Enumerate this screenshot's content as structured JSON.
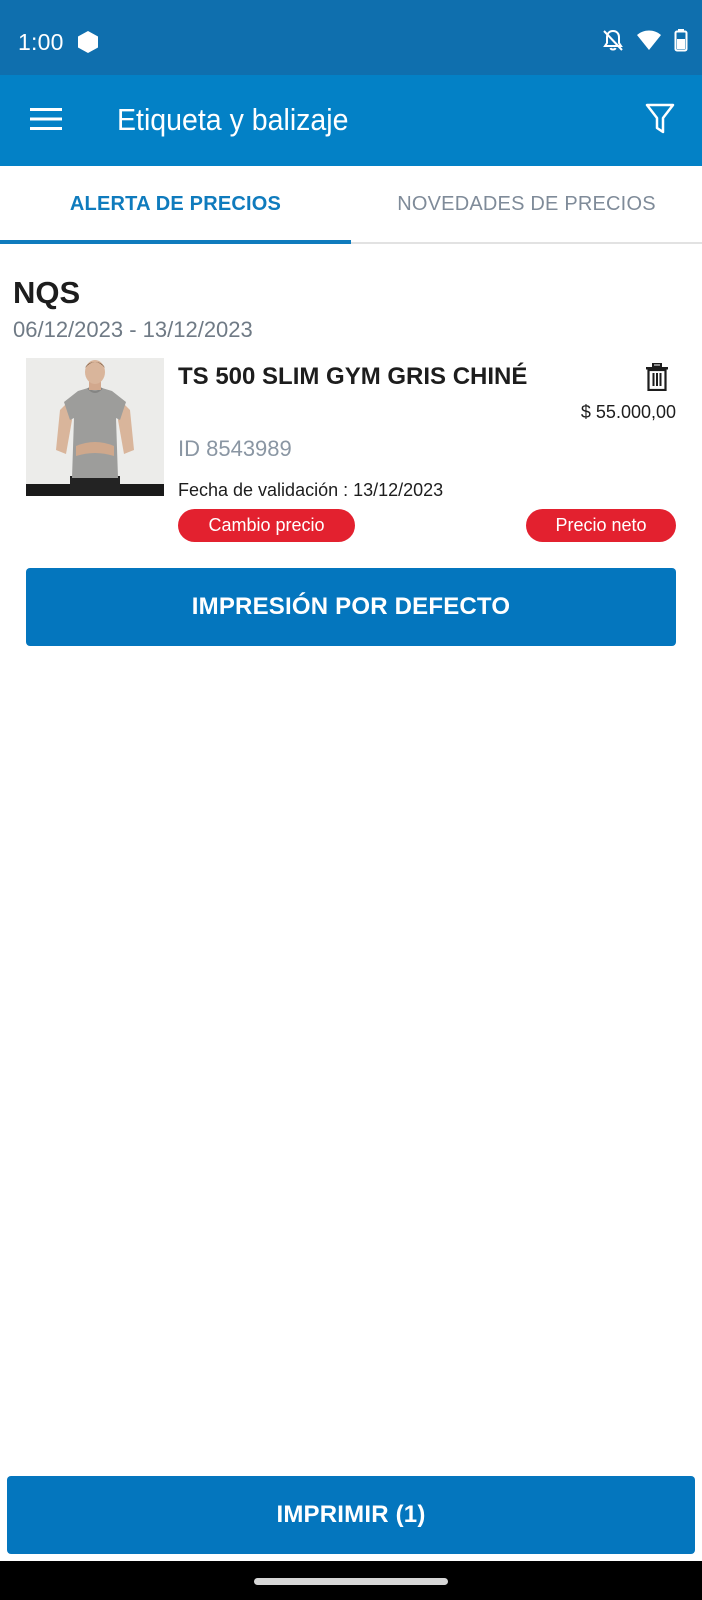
{
  "status_bar": {
    "time": "1:00",
    "icons": [
      "app-notification-icon",
      "silent-bell-icon",
      "wifi-icon",
      "battery-icon"
    ]
  },
  "app_bar": {
    "title": "Etiqueta y balizaje",
    "menu_icon": "menu-icon",
    "filter_icon": "filter-icon"
  },
  "tabs": [
    {
      "label": "ALERTA DE PRECIOS",
      "active": true
    },
    {
      "label": "NOVEDADES DE PRECIOS",
      "active": false
    }
  ],
  "group": {
    "name": "NQS",
    "date_range": "06/12/2023 - 13/12/2023"
  },
  "product": {
    "name": "TS 500 SLIM GYM GRIS CHINÉ",
    "id": "ID 8543989",
    "price": "$ 55.000,00",
    "validation_date": "Fecha de validación : 13/12/2023",
    "badges": [
      "Cambio precio",
      "Precio neto"
    ],
    "image_icon": "product-photo-tshirt",
    "delete_icon": "trash-icon"
  },
  "actions": {
    "default_print": "IMPRESIÓN POR DEFECTO",
    "print": "IMPRIMIR (1)"
  },
  "colors": {
    "status_bar": "#0f6fae",
    "app_bar": "#0381c6",
    "primary_button": "#0476be",
    "active_tab": "#0f7bbd",
    "badge": "#e3212f"
  }
}
